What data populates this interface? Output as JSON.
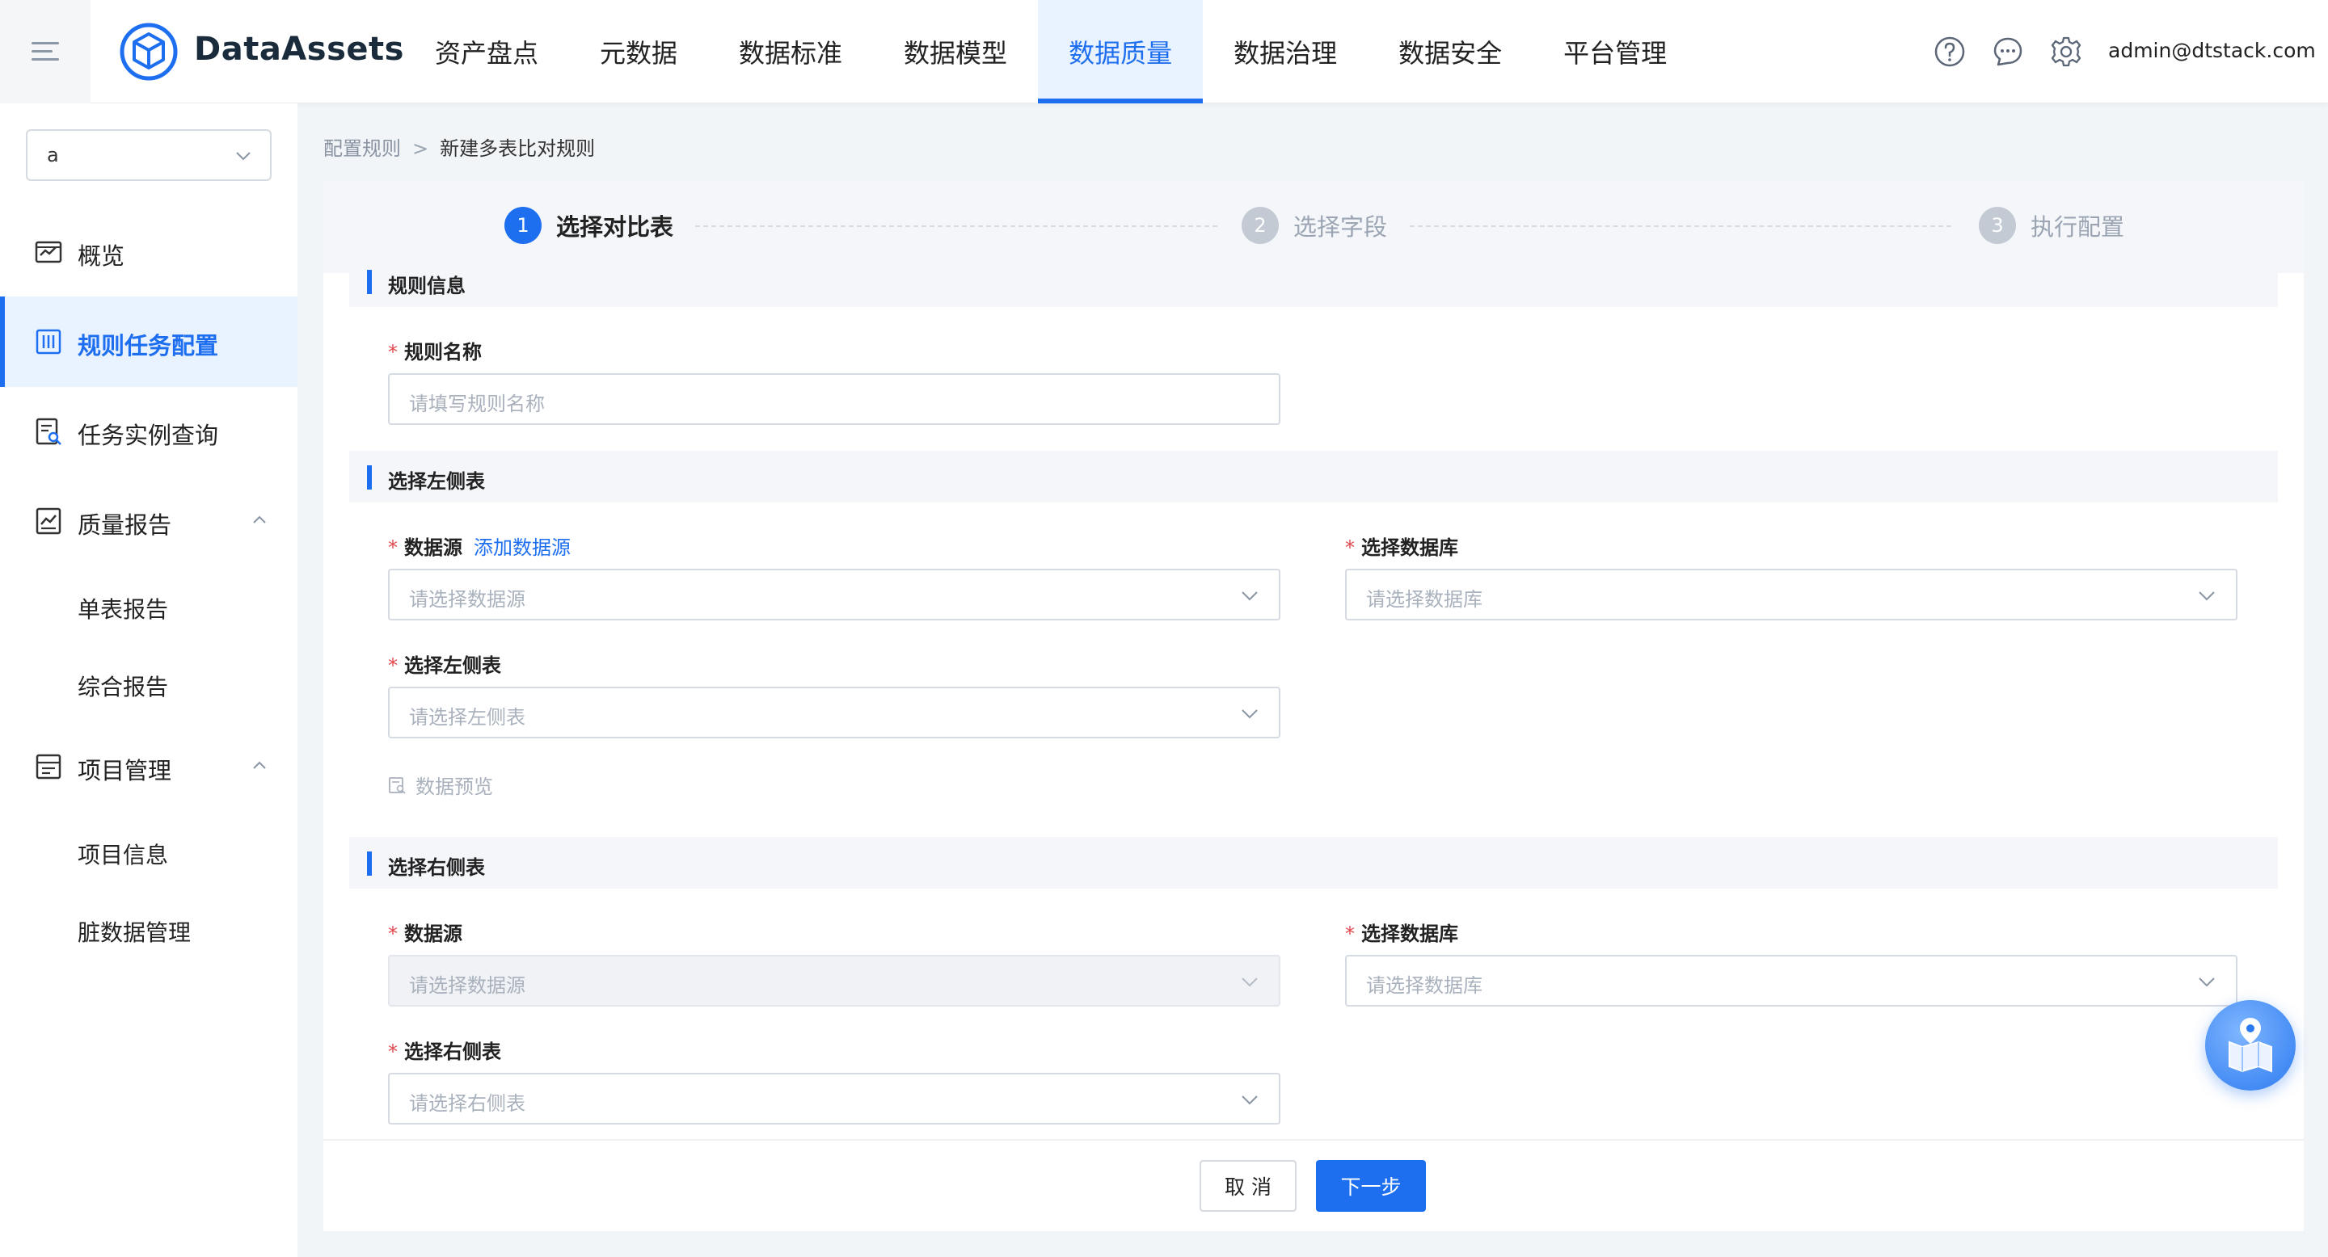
{
  "app": {
    "brand": "DataAssets",
    "nav": [
      "资产盘点",
      "元数据",
      "数据标准",
      "数据模型",
      "数据质量",
      "数据治理",
      "数据安全",
      "平台管理"
    ],
    "active_nav_index": 4,
    "user": "admin@dtstack.com",
    "icons": [
      "help-icon",
      "message-icon",
      "settings-icon"
    ]
  },
  "sidebar": {
    "project_select_value": "a",
    "items": [
      {
        "label": "概览",
        "icon": "overview-icon"
      },
      {
        "label": "规则任务配置",
        "icon": "rule-config-icon",
        "active": true
      },
      {
        "label": "任务实例查询",
        "icon": "instance-query-icon"
      },
      {
        "label": "质量报告",
        "icon": "report-icon",
        "expanded": true
      },
      {
        "label": "项目管理",
        "icon": "project-icon",
        "expanded": true
      }
    ],
    "report_children": [
      "单表报告",
      "综合报告"
    ],
    "project_children": [
      "项目信息",
      "脏数据管理"
    ]
  },
  "breadcrumb": {
    "parent": "配置规则",
    "current": "新建多表比对规则"
  },
  "steps": [
    {
      "num": "1",
      "label": "选择对比表",
      "active": true
    },
    {
      "num": "2",
      "label": "选择字段",
      "active": false
    },
    {
      "num": "3",
      "label": "执行配置",
      "active": false
    }
  ],
  "rule_info": {
    "section_title": "规则信息",
    "name_label": "规则名称",
    "name_placeholder": "请填写规则名称"
  },
  "left_table": {
    "section_title": "选择左侧表",
    "source_label": "数据源",
    "add_source_link": "添加数据源",
    "source_placeholder": "请选择数据源",
    "db_label": "选择数据库",
    "db_placeholder": "请选择数据库",
    "table_label": "选择左侧表",
    "table_placeholder": "请选择左侧表",
    "preview_label": "数据预览"
  },
  "right_table": {
    "section_title": "选择右侧表",
    "source_label": "数据源",
    "source_placeholder": "请选择数据源",
    "db_label": "选择数据库",
    "db_placeholder": "请选择数据库",
    "table_label": "选择右侧表",
    "table_placeholder": "请选择右侧表"
  },
  "footer": {
    "cancel_label": "取 消",
    "next_label": "下一步"
  },
  "colors": {
    "primary": "#1e6ff0",
    "required": "#e5484d"
  }
}
